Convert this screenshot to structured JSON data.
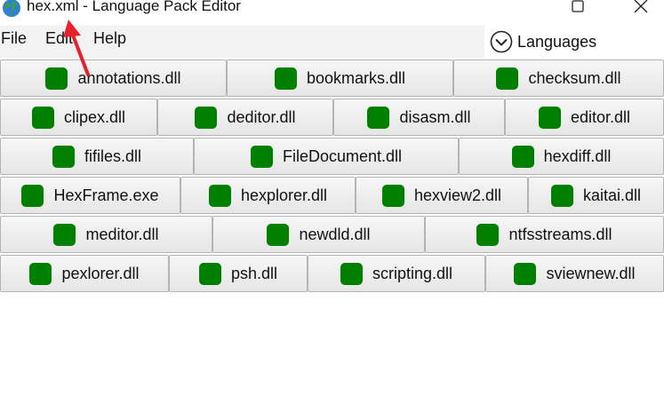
{
  "window": {
    "title": "hex.xml - Language Pack Editor",
    "app_icon": "globe-icon",
    "controls": [
      "maximize-icon",
      "close-icon"
    ]
  },
  "menubar": {
    "items": [
      {
        "label": "File"
      },
      {
        "label": "Edit"
      },
      {
        "label": "Help"
      }
    ],
    "languages": {
      "label": "Languages",
      "icon": "chevron-down-circle-icon"
    }
  },
  "modules": {
    "status_color": "#008000",
    "rows": [
      [
        {
          "label": "annotations.dll"
        },
        {
          "label": "bookmarks.dll"
        },
        {
          "label": "checksum.dll"
        }
      ],
      [
        {
          "label": "clipex.dll"
        },
        {
          "label": "deditor.dll"
        },
        {
          "label": "disasm.dll"
        },
        {
          "label": "editor.dll"
        }
      ],
      [
        {
          "label": "fifiles.dll"
        },
        {
          "label": "FileDocument.dll"
        },
        {
          "label": "hexdiff.dll"
        }
      ],
      [
        {
          "label": "HexFrame.exe"
        },
        {
          "label": "hexplorer.dll"
        },
        {
          "label": "hexview2.dll"
        },
        {
          "label": "kaitai.dll"
        }
      ],
      [
        {
          "label": "meditor.dll"
        },
        {
          "label": "newdld.dll"
        },
        {
          "label": "ntfsstreams.dll"
        }
      ],
      [
        {
          "label": "pexlorer.dll"
        },
        {
          "label": "psh.dll"
        },
        {
          "label": "scripting.dll"
        },
        {
          "label": "sviewnew.dll"
        }
      ]
    ]
  },
  "annotation": {
    "arrow_color": "#e8202a"
  }
}
